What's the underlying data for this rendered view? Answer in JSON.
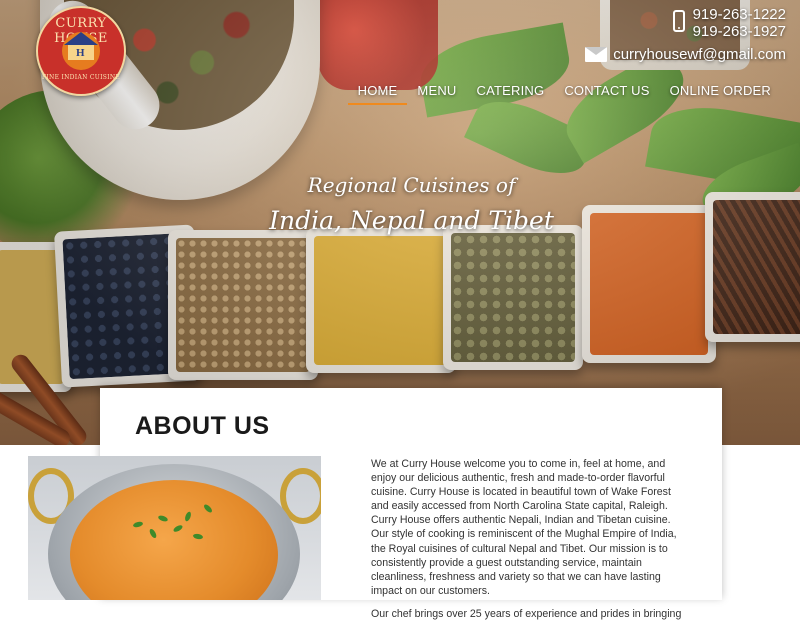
{
  "brand": {
    "logo_top": "CURRY HOUSE",
    "logo_bottom": "FINE INDIAN CUISINE",
    "logo_mark": "H"
  },
  "contact": {
    "phone_1": "919-263-1222",
    "phone_2": "919-263-1927",
    "email": "curryhousewf@gmail.com"
  },
  "nav": {
    "items": [
      {
        "label": "HOME",
        "active": true
      },
      {
        "label": "MENU"
      },
      {
        "label": "CATERING"
      },
      {
        "label": "CONTACT US"
      },
      {
        "label": "ONLINE ORDER"
      }
    ]
  },
  "hero": {
    "tagline_1": "Regional Cuisines of",
    "tagline_2": "India, Nepal and Tibet"
  },
  "about": {
    "title": "ABOUT US",
    "paragraph_1": "We at Curry House welcome you to come in, feel at home, and enjoy our delicious authentic, fresh and made-to-order flavorful cuisine. Curry House is located in beautiful town of Wake Forest and easily accessed from North Carolina State capital, Raleigh. Curry House offers authentic Nepali, Indian and Tibetan cuisine. Our style of cooking is reminiscent of the Mughal Empire of India, the Royal cuisines of cultural Nepal and Tibet. Our mission is to consistently provide a guest outstanding service, maintain cleanliness, freshness and variety so that we can have lasting impact on our customers.",
    "paragraph_2": "Our chef brings over 25 years of experience and prides in bringing"
  },
  "colors": {
    "accent": "#f08a1d",
    "logo_red": "#c8302a"
  }
}
